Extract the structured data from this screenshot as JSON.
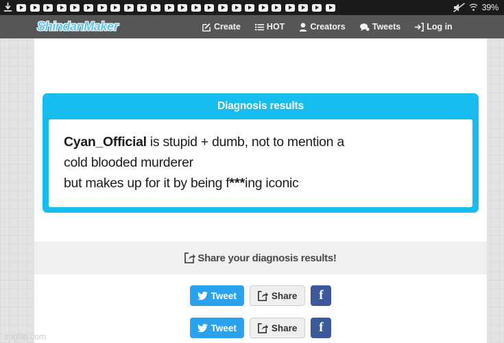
{
  "status_bar": {
    "download_icon": "download-icon",
    "notification_icon": "video-play-notification-icon",
    "notification_count": 24,
    "mute_icon": "volume-muted-icon",
    "wifi_icon": "wifi-icon",
    "battery_percent": "39%",
    "background_color": "#1b1b1b"
  },
  "navbar": {
    "brand": "ShindanMaker",
    "brand_color": "#5ec8ef",
    "background_color": "#565656",
    "items": [
      {
        "label": "Create",
        "icon": "pencil-square-icon"
      },
      {
        "label": "HOT",
        "icon": "list-icon"
      },
      {
        "label": "Creators",
        "icon": "user-icon"
      },
      {
        "label": "Tweets",
        "icon": "chat-bubble-icon"
      },
      {
        "label": "Log in",
        "icon": "sign-in-icon"
      }
    ]
  },
  "result_card": {
    "title": "Diagnosis results",
    "accent_color": "#18bdf0",
    "lines": [
      {
        "name": "Cyan_Official",
        "rest": " is stupid + dumb, not to mention a"
      },
      {
        "text": "cold blooded murderer"
      },
      {
        "prefix": "but makes up for it by being f",
        "censor": "***",
        "suffix": "ing iconic"
      }
    ]
  },
  "share_bar": {
    "icon": "share-icon",
    "text": "Share your diagnosis results!",
    "background_color": "#f0f0f0"
  },
  "share_buttons": {
    "tweet_label": "Tweet",
    "tweet_icon": "twitter-bird-icon",
    "tweet_color": "#2aa3ef",
    "share_label": "Share",
    "share_icon": "share-icon",
    "facebook_label": "f",
    "facebook_color": "#3b5998"
  },
  "watermark": "imgflip.com"
}
